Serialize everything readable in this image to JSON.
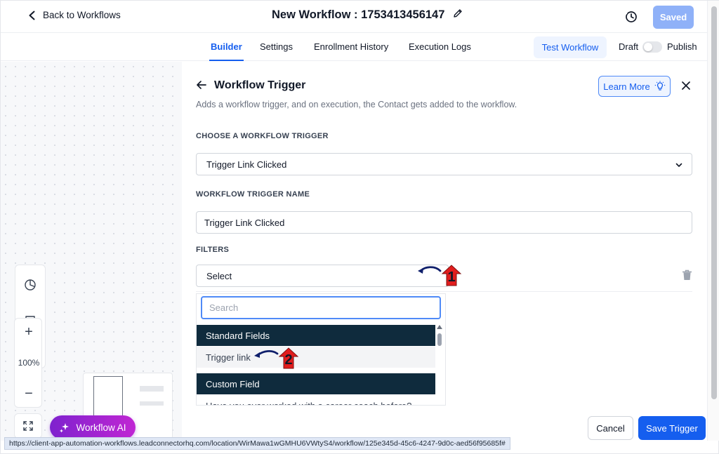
{
  "header": {
    "back_label": "Back to Workflows",
    "title": "New Workflow : 1753413456147",
    "saved_label": "Saved"
  },
  "tabs": [
    {
      "label": "Builder",
      "active": true
    },
    {
      "label": "Settings",
      "active": false
    },
    {
      "label": "Enrollment History",
      "active": false
    },
    {
      "label": "Execution Logs",
      "active": false
    }
  ],
  "actions": {
    "test_label": "Test Workflow",
    "draft_label": "Draft",
    "publish_label": "Publish",
    "publish_toggle_on": false
  },
  "canvas": {
    "zoom_label": "100%",
    "ai_label": "Workflow AI"
  },
  "panel": {
    "title": "Workflow Trigger",
    "description": "Adds a workflow trigger, and on execution, the Contact gets added to the workflow.",
    "learn_more_label": "Learn More",
    "trigger_section_label": "CHOOSE A WORKFLOW TRIGGER",
    "trigger_value": "Trigger Link Clicked",
    "name_section_label": "WORKFLOW TRIGGER NAME",
    "name_value": "Trigger Link Clicked",
    "filters_section_label": "FILTERS",
    "filter_select_value": "Select"
  },
  "dropdown": {
    "search_placeholder": "Search",
    "group_standard": "Standard Fields",
    "item_trigger_link": "Trigger link",
    "group_custom": "Custom Field",
    "item_custom_1": "Have you ever worked with a career coach before?"
  },
  "annotations": {
    "step1": "1",
    "step2": "2"
  },
  "footer": {
    "cancel_label": "Cancel",
    "save_label": "Save Trigger"
  },
  "status_url": "https://client-app-automation-workflows.leadconnectorhq.com/location/WirMawa1wGMHU6VWtyS4/workflow/125e345d-45c6-4247-9d0c-aed56f95685f#",
  "colors": {
    "primary": "#155eef",
    "primary_light": "#eef4ff",
    "dark_group": "#0f2b3d",
    "ai_gradient_start": "#7e22ce",
    "ai_gradient_end": "#c026d3",
    "annotation_red": "#e11d1d"
  },
  "icons": [
    "chevron-left-icon",
    "pencil-icon",
    "history-icon",
    "arrow-left-icon",
    "lightbulb-icon",
    "close-icon",
    "chevron-down-icon",
    "trash-icon",
    "pie-chart-icon",
    "comment-icon",
    "sticky-note-icon",
    "plus-icon",
    "minus-icon",
    "fit-screen-icon",
    "sparkles-icon"
  ]
}
